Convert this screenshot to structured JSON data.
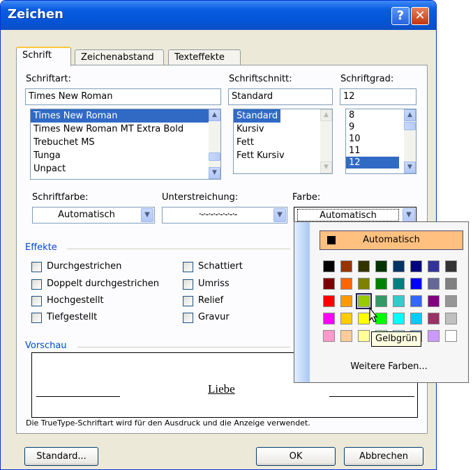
{
  "window": {
    "title": "Zeichen",
    "help_label": "?",
    "close_label": "✕"
  },
  "tabs": [
    {
      "label": "Schrift"
    },
    {
      "label": "Zeichenabstand"
    },
    {
      "label": "Texteffekte"
    }
  ],
  "font": {
    "label": "Schriftart:",
    "value": "Times New Roman",
    "items": [
      "Times New Roman",
      "Times New Roman MT Extra Bold",
      "Trebuchet MS",
      "Tunga",
      "Unpact"
    ],
    "selected": "Times New Roman"
  },
  "style": {
    "label": "Schriftschnitt:",
    "value": "Standard",
    "items": [
      "Standard",
      "Kursiv",
      "Fett",
      "Fett Kursiv"
    ],
    "selected": "Standard"
  },
  "size": {
    "label": "Schriftgrad:",
    "value": "12",
    "items": [
      "8",
      "9",
      "10",
      "11",
      "12"
    ],
    "selected": "12"
  },
  "font_color": {
    "label": "Schriftfarbe:",
    "value": "Automatisch"
  },
  "underline": {
    "label": "Unterstreichung:",
    "value": "·-·-·-·-·-·-·-·-"
  },
  "underline_color": {
    "label": "Farbe:",
    "value": "Automatisch"
  },
  "effects": {
    "label": "Effekte",
    "col1": [
      "Durchgestrichen",
      "Doppelt durchgestrichen",
      "Hochgestellt",
      "Tiefgestellt"
    ],
    "col2": [
      "Schattiert",
      "Umriss",
      "Relief",
      "Gravur"
    ]
  },
  "preview": {
    "label": "Vorschau",
    "text": "Liebe",
    "note": "Die TrueType-Schriftart wird für den Ausdruck und die Anzeige verwendet."
  },
  "buttons": {
    "default": "Standard...",
    "ok": "OK",
    "cancel": "Abbrechen"
  },
  "color_popup": {
    "auto_label": "Automatisch",
    "more_label": "Weitere Farben...",
    "tooltip": "Gelbgrün",
    "selected_color": "#99CC00",
    "palette": [
      [
        "#000000",
        "#993300",
        "#333300",
        "#003300",
        "#003366",
        "#000080",
        "#333399",
        "#333333"
      ],
      [
        "#800000",
        "#FF6600",
        "#808000",
        "#008000",
        "#008080",
        "#0000FF",
        "#666699",
        "#808080"
      ],
      [
        "#FF0000",
        "#FF9900",
        "#99CC00",
        "#339966",
        "#33CCCC",
        "#3366FF",
        "#800080",
        "#969696"
      ],
      [
        "#FF00FF",
        "#FFCC00",
        "#FFFF00",
        "#00FF00",
        "#00FFFF",
        "#00CCFF",
        "#993366",
        "#C0C0C0"
      ],
      [
        "#FF99CC",
        "#FFCC99",
        "#FFFF99",
        "#CCFFCC",
        "#CCFFFF",
        "#99CCFF",
        "#CC99FF",
        "#FFFFFF"
      ]
    ]
  }
}
